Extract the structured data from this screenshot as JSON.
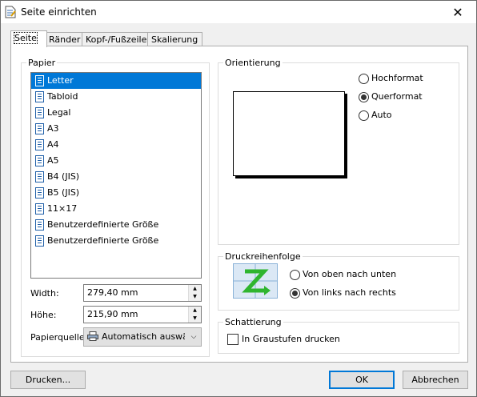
{
  "window": {
    "title": "Seite einrichten",
    "close_symbol": "✕"
  },
  "tabs": [
    {
      "label": "Seite",
      "active": true
    },
    {
      "label": "Ränder",
      "active": false
    },
    {
      "label": "Kopf-/Fußzeile",
      "active": false
    },
    {
      "label": "Skalierung",
      "active": false
    }
  ],
  "paper": {
    "group_label": "Papier",
    "items": [
      {
        "label": "Letter",
        "selected": true
      },
      {
        "label": "Tabloid"
      },
      {
        "label": "Legal"
      },
      {
        "label": "A3"
      },
      {
        "label": "A4"
      },
      {
        "label": "A5"
      },
      {
        "label": "B4 (JIS)"
      },
      {
        "label": "B5 (JIS)"
      },
      {
        "label": "11×17"
      },
      {
        "label": "Benutzerdefinierte Größe"
      },
      {
        "label": "Benutzerdefinierte Größe"
      }
    ],
    "width_label": "Width:",
    "width_value": "279,40 mm",
    "height_label": "Höhe:",
    "height_value": "215,90 mm",
    "source_label": "Papierquelle:",
    "source_value": "Automatisch auswählen"
  },
  "orientation": {
    "group_label": "Orientierung",
    "options": [
      {
        "label": "Hochformat",
        "checked": false
      },
      {
        "label": "Querformat",
        "checked": true
      },
      {
        "label": "Auto",
        "checked": false
      }
    ]
  },
  "print_order": {
    "group_label": "Druckreihenfolge",
    "options": [
      {
        "label": "Von oben nach unten",
        "checked": false
      },
      {
        "label": "Von links nach rechts",
        "checked": true
      }
    ]
  },
  "shading": {
    "group_label": "Schattierung",
    "checkbox_label": "In Graustufen drucken",
    "checked": false
  },
  "buttons": {
    "print": "Drucken...",
    "ok": "OK",
    "cancel": "Abbrechen"
  },
  "colors": {
    "selection": "#0078d7",
    "default_button_border": "#0078d7",
    "z_arrow": "#2fb52f"
  },
  "icons": {
    "title": "page-setup-icon",
    "list_item": "document-icon",
    "source": "printer-icon"
  }
}
